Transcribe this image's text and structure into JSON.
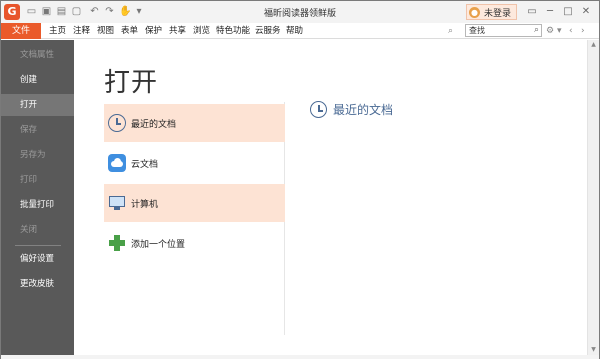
{
  "window": {
    "title": "福昕阅读器领鲜版"
  },
  "quick_access": {
    "icons": [
      "open-icon",
      "save-icon",
      "print-icon",
      "create-icon",
      "undo-icon",
      "redo-icon",
      "hand-tool-icon",
      "customize-icon"
    ]
  },
  "account": {
    "login_label": "未登录"
  },
  "window_controls": [
    "pin",
    "minimize",
    "maximize",
    "close"
  ],
  "menubar": {
    "file_label": "文件",
    "items": [
      "主页",
      "注释",
      "视图",
      "表单",
      "保护",
      "共享",
      "浏览",
      "特色功能",
      "云服务",
      "帮助"
    ],
    "search": {
      "value": "查找",
      "placeholder": "查找"
    }
  },
  "sidebar": {
    "items": [
      {
        "label": "文档属性",
        "enabled": false
      },
      {
        "label": "创建",
        "enabled": true
      },
      {
        "label": "打开",
        "enabled": true,
        "active": true
      },
      {
        "label": "保存",
        "enabled": false
      },
      {
        "label": "另存为",
        "enabled": false
      },
      {
        "label": "打印",
        "enabled": false
      },
      {
        "label": "批量打印",
        "enabled": true
      },
      {
        "label": "关闭",
        "enabled": false
      },
      {
        "label": "偏好设置",
        "enabled": true
      },
      {
        "label": "更改皮肤",
        "enabled": true
      }
    ]
  },
  "main": {
    "heading": "打开",
    "locations": [
      {
        "label": "最近的文档",
        "icon": "clock-icon",
        "selected": true
      },
      {
        "label": "云文档",
        "icon": "cloud-icon",
        "selected": false
      },
      {
        "label": "计算机",
        "icon": "computer-icon",
        "selected": true
      },
      {
        "label": "添加一个位置",
        "icon": "plus-icon",
        "selected": false
      }
    ],
    "panel_title": "最近的文档"
  },
  "colors": {
    "accent": "#ea5a2a",
    "sidebar_bg": "#595959",
    "selection_bg": "#fde3d4",
    "link_blue": "#4a6a94"
  }
}
